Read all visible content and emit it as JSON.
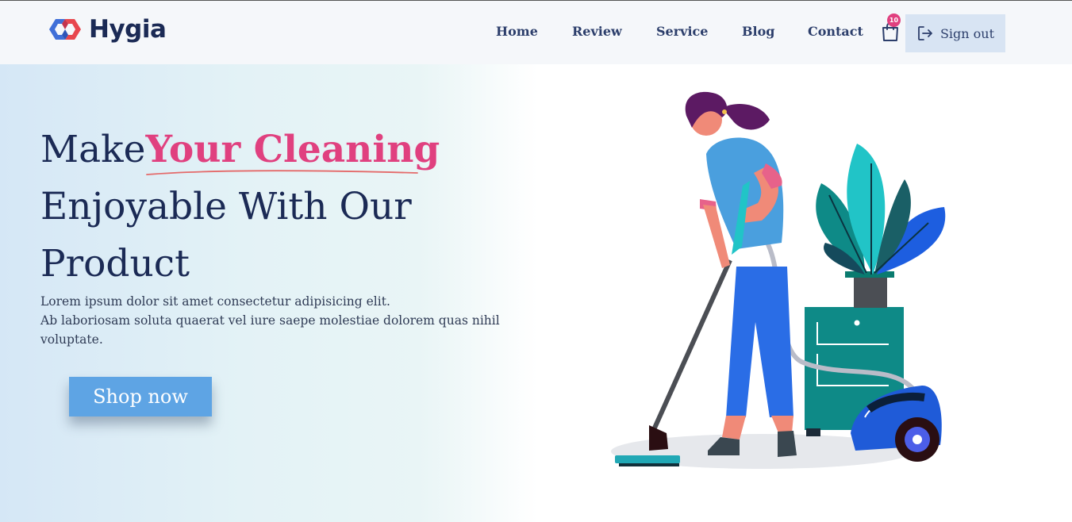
{
  "brand": {
    "name": "Hygia"
  },
  "nav": {
    "links": [
      "Home",
      "Review",
      "Service",
      "Blog",
      "Contact"
    ],
    "cart_count": "10",
    "signout_label": "Sign out"
  },
  "hero": {
    "headline_start": "Make",
    "headline_highlight": "Your Cleaning",
    "headline_line2": "Enjoyable With Our",
    "headline_line3": "Product",
    "description_line1": "Lorem ipsum dolor sit amet consectetur adipisicing elit.",
    "description_line2": "Ab laboriosam soluta quaerat vel iure saepe molestiae dolorem quas nihil voluptate.",
    "cta_label": "Shop now"
  },
  "icons": {
    "logo": "hexagon-link-logo",
    "cart": "shopping-bag-icon",
    "signout": "sign-out-icon"
  },
  "colors": {
    "navy": "#1b2a55",
    "accent_pink": "#e0407f",
    "button_blue": "#5ea4e4",
    "signout_bg": "#d8e4f3"
  }
}
